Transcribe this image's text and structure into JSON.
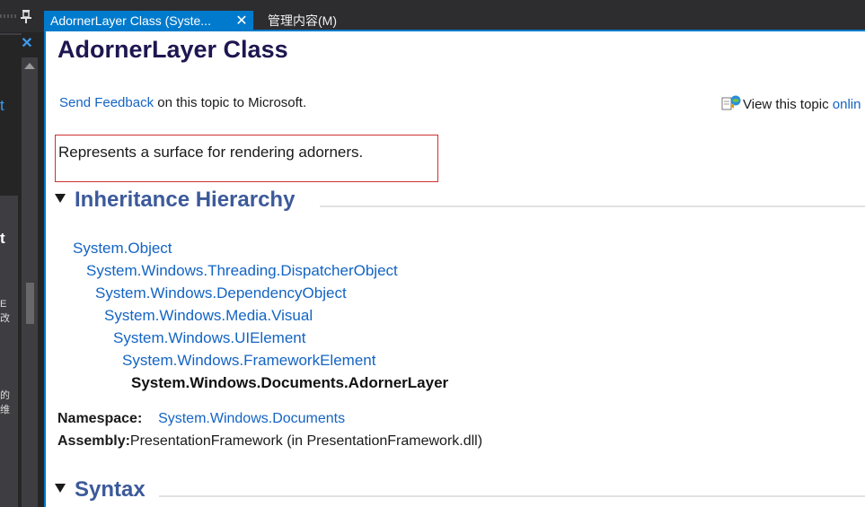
{
  "left_panel": {
    "close_glyph": "✕",
    "text_t1": "t",
    "text_t2": "t",
    "cjk1": "E 改",
    "cjk2": "的 维"
  },
  "tabs": [
    {
      "label": "AdornerLayer Class (Syste...",
      "close_glyph": "✕"
    },
    {
      "label": "管理内容(M)"
    }
  ],
  "doc": {
    "title": "AdornerLayer Class",
    "feedback_link": "Send Feedback",
    "feedback_rest": " on this topic to Microsoft.",
    "view_text": "View this topic ",
    "view_link": "onlin",
    "summary": "Represents a surface for rendering adorners.",
    "sections": {
      "inheritance": "Inheritance Hierarchy",
      "syntax": "Syntax"
    },
    "hierarchy": [
      "System.Object",
      "System.Windows.Threading.DispatcherObject",
      "System.Windows.DependencyObject",
      "System.Windows.Media.Visual",
      "System.Windows.UIElement",
      "System.Windows.FrameworkElement"
    ],
    "hierarchy_current": "System.Windows.Documents.AdornerLayer",
    "namespace_label": "Namespace:",
    "namespace_value": "System.Windows.Documents",
    "assembly_label": "Assembly:",
    "assembly_value": "PresentationFramework (in PresentationFramework.dll)"
  },
  "colors": {
    "accent": "#007acc",
    "link": "#1364c4",
    "heading": "#3c5a9a",
    "title": "#1e1650",
    "summary_border": "#d03030"
  },
  "icons": [
    "pin-icon",
    "close-icon",
    "scroll-up-arrow-icon",
    "view-online-icon",
    "collapse-arrow-icon"
  ]
}
